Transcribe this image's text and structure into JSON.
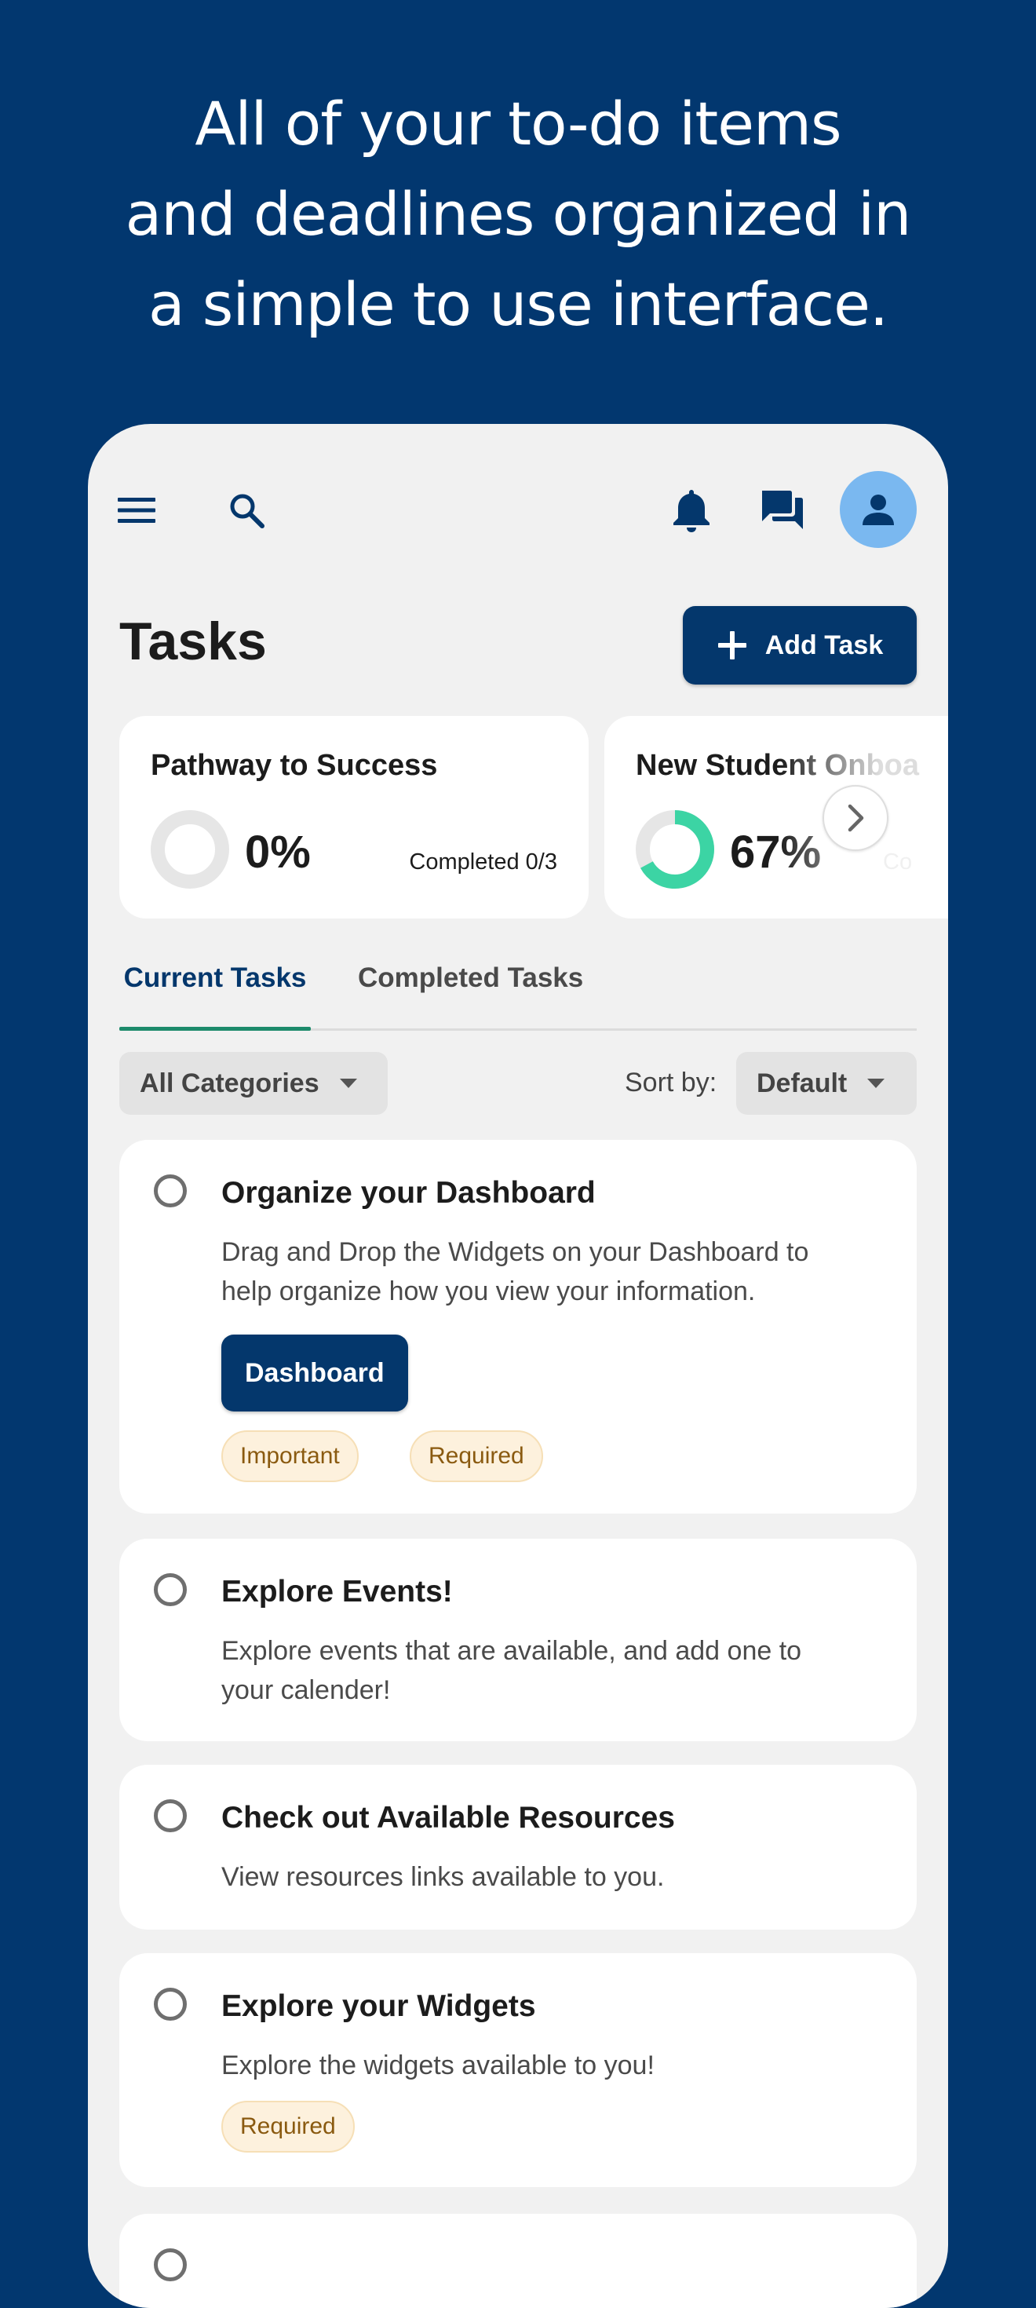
{
  "hero": {
    "line1": "All of your to-do items",
    "line2": "and deadlines organized in",
    "line3": "a simple to use interface."
  },
  "topbar": {
    "icons": [
      "menu-icon",
      "search-icon",
      "bell-icon",
      "chat-icon",
      "person-icon"
    ]
  },
  "page": {
    "title": "Tasks",
    "add_task_label": "Add Task"
  },
  "progress_cards": [
    {
      "title": "Pathway to Success",
      "percent_label": "0%",
      "progress": 0,
      "completed_label": "Completed 0/3"
    },
    {
      "title": "New Student Onboa",
      "percent_label": "67%",
      "progress": 0.67,
      "completed_label": "Co"
    }
  ],
  "tabs": {
    "current": "Current Tasks",
    "completed": "Completed Tasks"
  },
  "filters": {
    "category_value": "All Categories",
    "sort_label": "Sort by:",
    "sort_value": "Default"
  },
  "tasks": [
    {
      "title": "Organize your Dashboard",
      "desc_line1": "Drag and Drop the Widgets on your Dashboard to",
      "desc_line2": "help organize how you view your information.",
      "action_label": "Dashboard",
      "tags": [
        "Important",
        "Required"
      ]
    },
    {
      "title": "Explore Events!",
      "desc_line1": "Explore events that are available, and add one to",
      "desc_line2": "your calender!"
    },
    {
      "title": "Check out Available Resources",
      "desc_line1": "View resources links available to you."
    },
    {
      "title": "Explore your Widgets",
      "desc_line1": "Explore the widgets available to you!",
      "tags": [
        "Required"
      ]
    }
  ],
  "colors": {
    "background": "#02376f",
    "primary": "#04376c",
    "accent_teal": "#3cd4a4",
    "tab_underline": "#1c8a6b",
    "avatar_bg": "#7ab8f0",
    "tag_bg": "#fdf1dd",
    "tag_text": "#8a5a10"
  }
}
